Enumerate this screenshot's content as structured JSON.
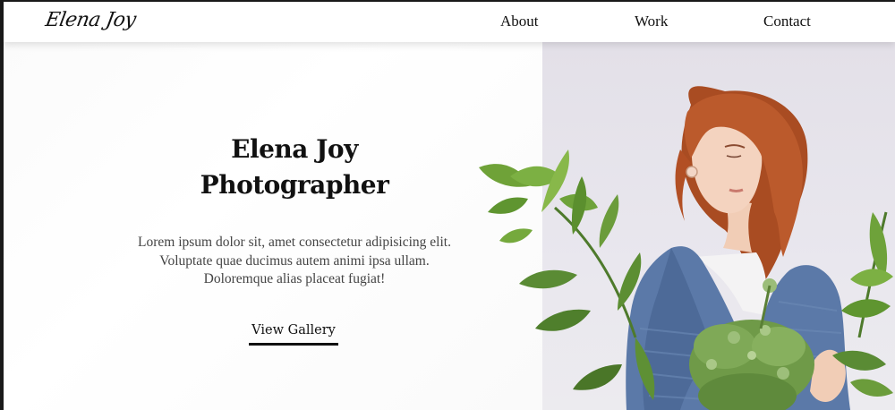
{
  "header": {
    "logo": "Elena Joy",
    "nav": [
      {
        "label": "About"
      },
      {
        "label": "Work"
      },
      {
        "label": "Contact"
      }
    ]
  },
  "hero": {
    "title_line1": "Elena Joy",
    "title_line2": "Photographer",
    "description_lines": [
      "Lorem ipsum dolor sit, amet consectetur adipisicing elit.",
      "Voluptate quae ducimus autem animi ipsa ullam.",
      "Doloremque alias placeat fugiat!"
    ],
    "cta_label": "View Gallery"
  },
  "colors": {
    "text": "#111111",
    "description": "#444444",
    "photo_background": "#e6e3ea",
    "sweater": "#5b79a8",
    "hair": "#b5542a",
    "leaves": "#5f8f3a"
  }
}
